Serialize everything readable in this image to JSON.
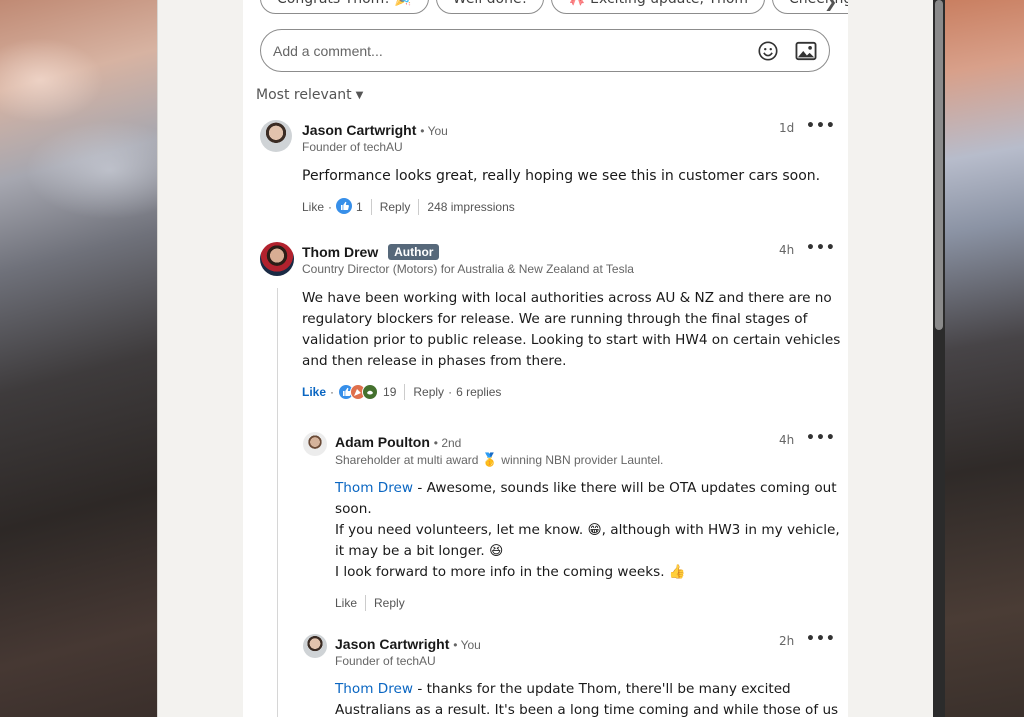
{
  "quick_replies": [
    "Congrats Thom! 🎉",
    "Well done!",
    "🎀 Exciting update, Thom",
    "Cheering"
  ],
  "comment_input": {
    "placeholder": "Add a comment..."
  },
  "sort_label": "Most relevant",
  "comments": [
    {
      "name": "Jason Cartwright",
      "degree": "• You",
      "subtitle": "Founder of techAU",
      "time": "1d",
      "text": "Performance looks great, really hoping we see this in customer cars soon.",
      "like_label": "Like",
      "reaction_count": "1",
      "reply_label": "Reply",
      "extra": "248 impressions"
    },
    {
      "name": "Thom Drew",
      "badge": "Author",
      "subtitle": "Country Director (Motors) for Australia & New Zealand at Tesla",
      "time": "4h",
      "text_lines": [
        "We have been working with local authorities across AU & NZ and there are no",
        "regulatory blockers for release. We are running through the final stages of",
        "validation prior to public release. Looking to start with HW4 on certain vehicles",
        "and then release in phases from there."
      ],
      "like_label": "Like",
      "reaction_count": "19",
      "reply_label": "Reply",
      "replies_count": "6 replies"
    }
  ],
  "replies": [
    {
      "name": "Adam Poulton",
      "degree": "• 2nd",
      "subtitle_pre": "Shareholder at multi award",
      "subtitle_emoji": "🥇",
      "subtitle_post": "winning NBN provider Launtel.",
      "time": "4h",
      "mention": "Thom Drew",
      "line1": " - Awesome, sounds like there will be OTA updates coming out",
      "line2": "soon.",
      "line3": "If you need volunteers, let me know. 😁, although with HW3 in my vehicle,",
      "line4": "it may be a bit longer. 😆",
      "line5": "I look forward to more info in the coming weeks. 👍",
      "like_label": "Like",
      "reply_label": "Reply"
    },
    {
      "name": "Jason Cartwright",
      "degree": "• You",
      "subtitle": "Founder of techAU",
      "time": "2h",
      "mention": "Thom Drew",
      "line1": " - thanks for the update Thom, there'll be many excited",
      "line2": "Australians as a result. It's been a long time coming and while those of us"
    }
  ]
}
